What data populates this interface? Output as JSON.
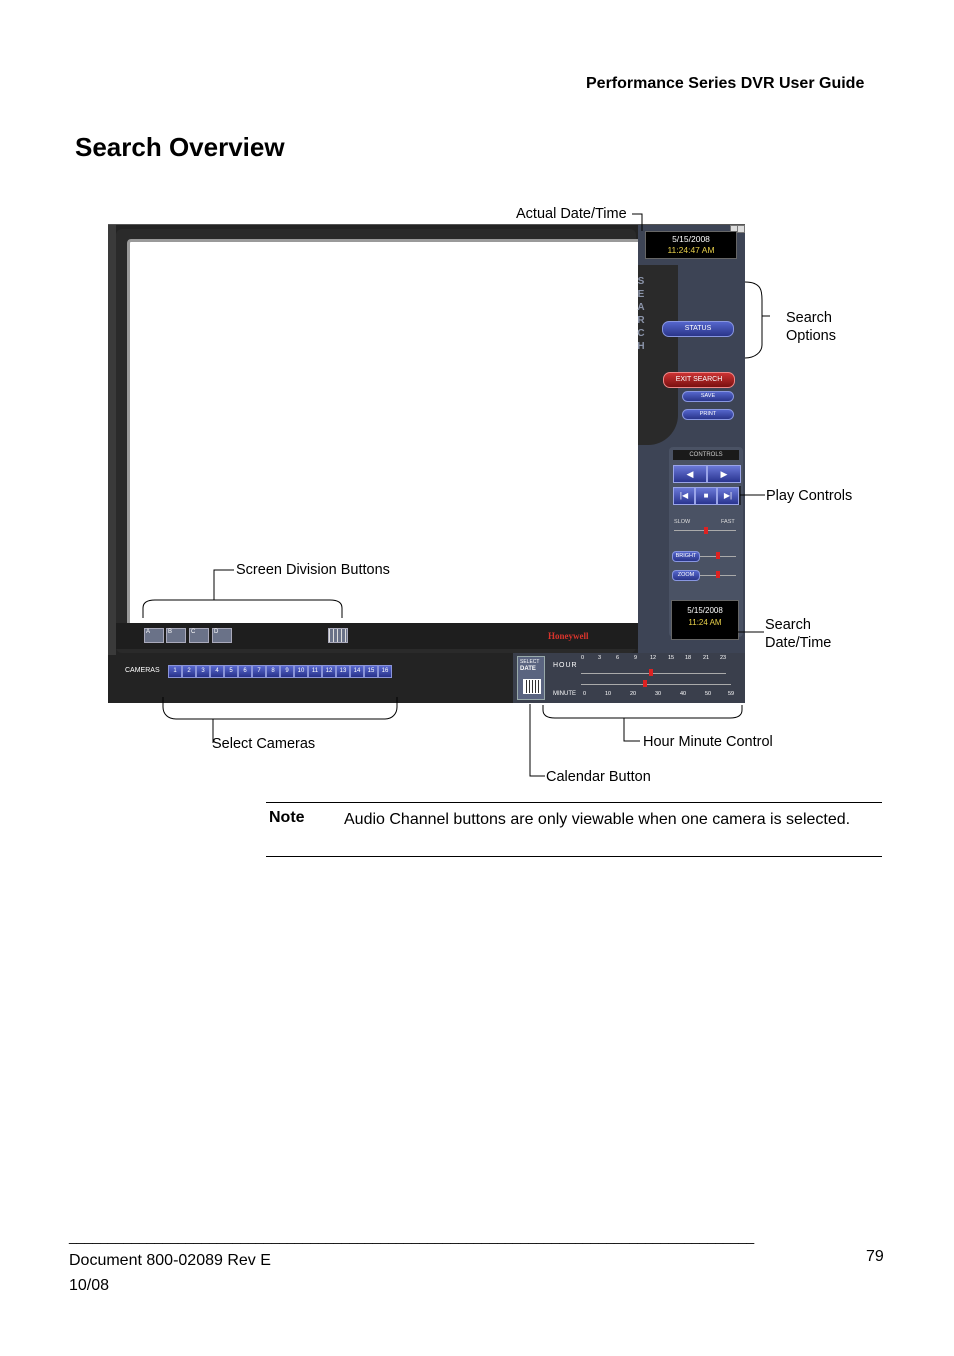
{
  "header": {
    "title": "Performance Series DVR User Guide"
  },
  "page_title": "Search Overview",
  "callouts": {
    "actual_date_time": "Actual Date/Time",
    "search_options_line1": "Search",
    "search_options_line2": "Options",
    "play_controls": "Play Controls",
    "screen_division_buttons": "Screen Division Buttons",
    "search_date_time_line1": "Search",
    "search_date_time_line2": "Date/Time",
    "select_cameras": "Select Cameras",
    "hour_minute_control": "Hour Minute Control",
    "calendar_button": "Calendar Button"
  },
  "dvr": {
    "actual_date": "5/15/2008",
    "actual_time": "11:24:47 AM",
    "search_letters": [
      "S",
      "E",
      "A",
      "R",
      "C",
      "H"
    ],
    "status_label": "STATUS",
    "exit_search_label": "EXIT SEARCH",
    "save_label": "SAVE",
    "print_label": "PRINT",
    "controls_label": "CONTROLS",
    "slow_label": "SLOW",
    "fast_label": "FAST",
    "bright_label": "BRIGHT",
    "zoom_label": "ZOOM",
    "search_date": "5/15/2008",
    "search_time": "11:24 AM",
    "division_buttons": [
      "A",
      "B",
      "C",
      "D"
    ],
    "logo": "Honeywell",
    "cameras_label": "CAMERAS",
    "cameras": [
      "1",
      "2",
      "3",
      "4",
      "5",
      "6",
      "7",
      "8",
      "9",
      "10",
      "11",
      "12",
      "13",
      "14",
      "15",
      "16"
    ],
    "select_date_line1": "SELECT",
    "select_date_line2": "DATE",
    "hour_label": "HOUR",
    "minute_label": "MINUTE",
    "hour_ticks": [
      "0",
      "3",
      "6",
      "9",
      "12",
      "15",
      "18",
      "21",
      "23"
    ],
    "minute_ticks": [
      "0",
      "10",
      "20",
      "30",
      "40",
      "50",
      "59"
    ]
  },
  "note": {
    "label": "Note",
    "text": "Audio Channel buttons are only viewable when one camera is selected."
  },
  "footer": {
    "rule": "________________________________________________________________________________________",
    "document": "Document 800-02089  Rev E",
    "date": "10/08",
    "page_number": "79"
  }
}
